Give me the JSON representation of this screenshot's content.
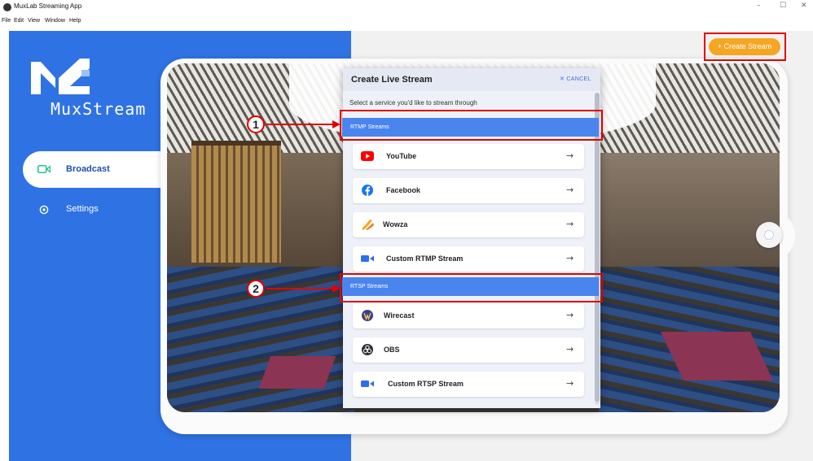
{
  "window": {
    "title": "MuxLab Streaming App",
    "minimize": "–",
    "maximize": "☐",
    "close": "✕"
  },
  "menu": [
    "File",
    "Edit",
    "View",
    "Window",
    "Help"
  ],
  "brand": {
    "logo_text": "MuxStream"
  },
  "sidebar": {
    "items": [
      {
        "label": "Broadcast",
        "icon": "camera-icon",
        "active": true
      },
      {
        "label": "Settings",
        "icon": "gear-icon",
        "active": false
      }
    ]
  },
  "toolbar": {
    "create_stream_label": "+ Create Stream"
  },
  "modal": {
    "title": "Create Live Stream",
    "cancel_label": "✕ CANCEL",
    "subtitle": "Select a service you'd like to stream through",
    "sections": [
      {
        "label": "RTMP Streams",
        "services": [
          {
            "label": "YouTube",
            "icon": "youtube-icon"
          },
          {
            "label": "Facebook",
            "icon": "facebook-icon"
          },
          {
            "label": "Wowza",
            "icon": "wowza-icon"
          },
          {
            "label": "Custom RTMP Stream",
            "icon": "camera-icon"
          }
        ]
      },
      {
        "label": "RTSP Streams",
        "services": [
          {
            "label": "Wirecast",
            "icon": "wirecast-icon"
          },
          {
            "label": "OBS",
            "icon": "obs-icon"
          },
          {
            "label": "Custom RTSP Stream",
            "icon": "camera-icon"
          }
        ]
      }
    ]
  },
  "annotations": {
    "callout_1": "1",
    "callout_2": "2"
  },
  "colors": {
    "brand_blue": "#2f72e4",
    "section_blue": "#4a85ee",
    "accent_orange": "#f5a623",
    "highlight_red": "#e30000"
  }
}
